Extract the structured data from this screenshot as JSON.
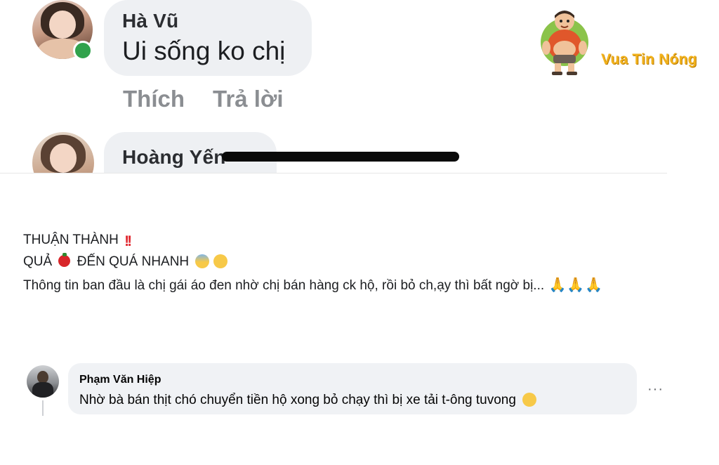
{
  "top_comments": [
    {
      "name": "Hà Vũ",
      "text": "Ui sống ko chị",
      "actions": {
        "like": "Thích",
        "reply": "Trả lời"
      },
      "online": true
    },
    {
      "name": "Hoàng Yến",
      "redacted": true
    }
  ],
  "logo": {
    "text": "Vua Tin Nóng"
  },
  "post": {
    "line1": "THUẬN THÀNH",
    "line2_a": "QUẢ",
    "line2_b": "ĐẾN QUÁ NHANH",
    "line3": "Thông tin ban đầu là chị gái áo đen nhờ chị bán hàng ck hộ, rồi bỏ ch,ạy thì bất ngờ bị...",
    "emojis": {
      "line1": "double-exclamation",
      "line2_mid": "tomato",
      "line2_end": [
        "anxious-sweat-face",
        "disappointed-face"
      ],
      "line3_end": [
        "folded-hands",
        "folded-hands",
        "folded-hands"
      ]
    }
  },
  "bottom_comment": {
    "name": "Phạm Văn Hiệp",
    "text": "Nhờ bà bán thịt chó chuyển tiền hộ xong bỏ chạy thì bị xe tải t-ông tuvong",
    "end_emoji": "sad-face",
    "more_label": "···"
  }
}
